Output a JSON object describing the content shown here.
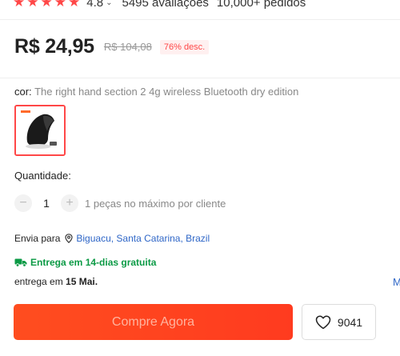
{
  "rating": {
    "stars": [
      "★",
      "★",
      "★",
      "★",
      "★"
    ],
    "value": "4.8",
    "chevron": "⌄",
    "reviews": "5495 avaliações",
    "orders": "10,000+ pedidos"
  },
  "price": {
    "current": "R$ 24,95",
    "original": "R$ 104,08",
    "discount": "76% desc."
  },
  "color": {
    "label": "cor: ",
    "value": "The right hand section 2 4g wireless Bluetooth dry edition",
    "thumbnail_icon": "vertical-mouse-image"
  },
  "quantity": {
    "label": "Quantidade:",
    "decrement": "−",
    "value": "1",
    "increment": "+",
    "note": "1 peças no máximo por cliente"
  },
  "shipping": {
    "label": "Envia para",
    "location": "Biguacu, Santa Catarina, Brazil",
    "free_delivery": "Entrega em 14-dias gratuita",
    "delivery_prefix": "entrega em ",
    "delivery_date": "15 Mai.",
    "more_cut": "M"
  },
  "actions": {
    "buy_label": "Compre Agora",
    "wishlist_count": "9041"
  },
  "colors": {
    "accent": "#ff4747",
    "buy_button": "#ff4d1f",
    "link": "#2e66c7",
    "free_shipping": "#0b9a45"
  }
}
